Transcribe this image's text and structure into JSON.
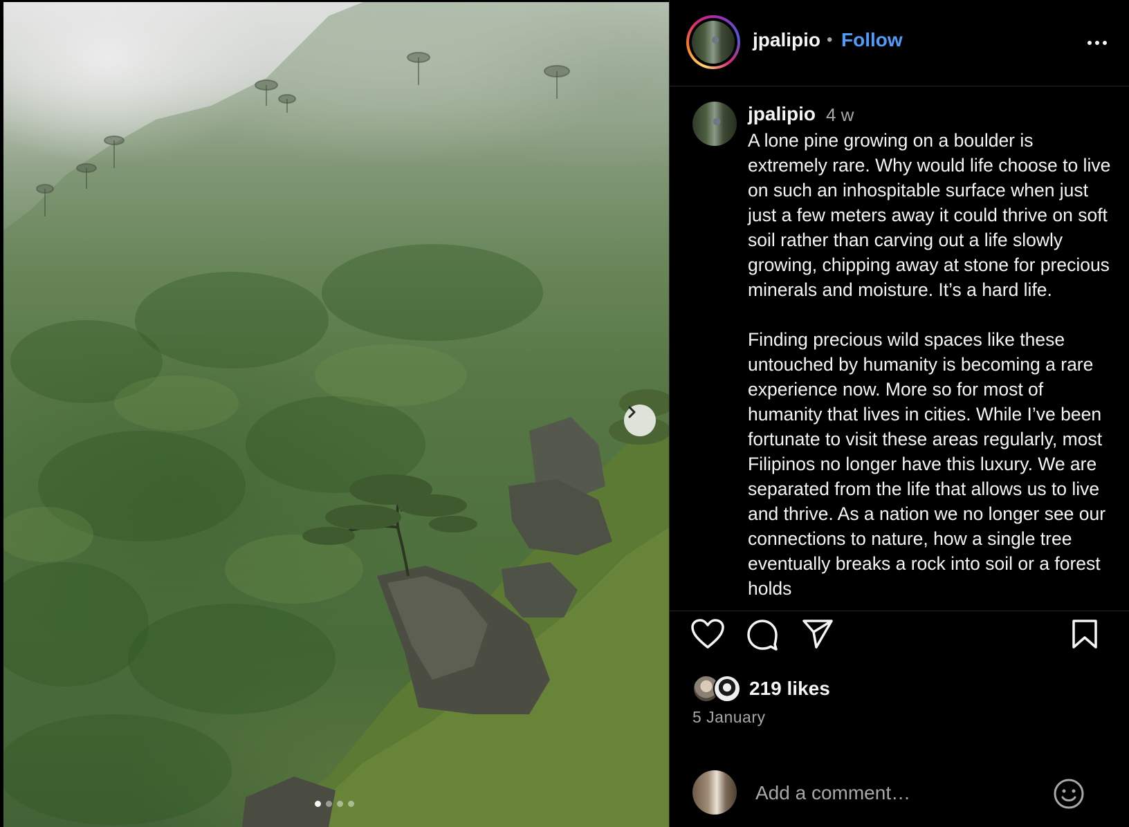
{
  "post": {
    "username": "jpalipio",
    "separator": "•",
    "follow_label": "Follow",
    "more_icon": "more-horizontal-icon",
    "carousel": {
      "current_slide": 1,
      "total_slides": 4,
      "next_icon": "chevron-right-icon"
    }
  },
  "caption": {
    "username": "jpalipio",
    "time": "4 w",
    "text": "A lone pine growing on a boulder is extremely rare. Why would life choose to live on such an inhospitable surface when just just a few meters away it could thrive on soft soil rather than carving out a life slowly growing, chipping away at stone for precious minerals and moisture. It’s a hard life.\n\nFinding precious wild spaces like these untouched by humanity is becoming a rare experience now. More so for most of humanity that lives in cities. While I’ve been fortunate to visit these areas regularly, most Filipinos no longer have this luxury. We are separated from the life that allows us to live and thrive. As a nation we no longer see our connections to nature, how a single tree eventually breaks a rock into soil or a forest holds"
  },
  "actions": {
    "like_icon": "heart-icon",
    "comment_icon": "comment-icon",
    "share_icon": "send-icon",
    "save_icon": "bookmark-icon"
  },
  "engagement": {
    "likes": "219 likes",
    "date": "5 January"
  },
  "comment": {
    "placeholder": "Add a comment…",
    "emoji_icon": "smiley-icon"
  }
}
